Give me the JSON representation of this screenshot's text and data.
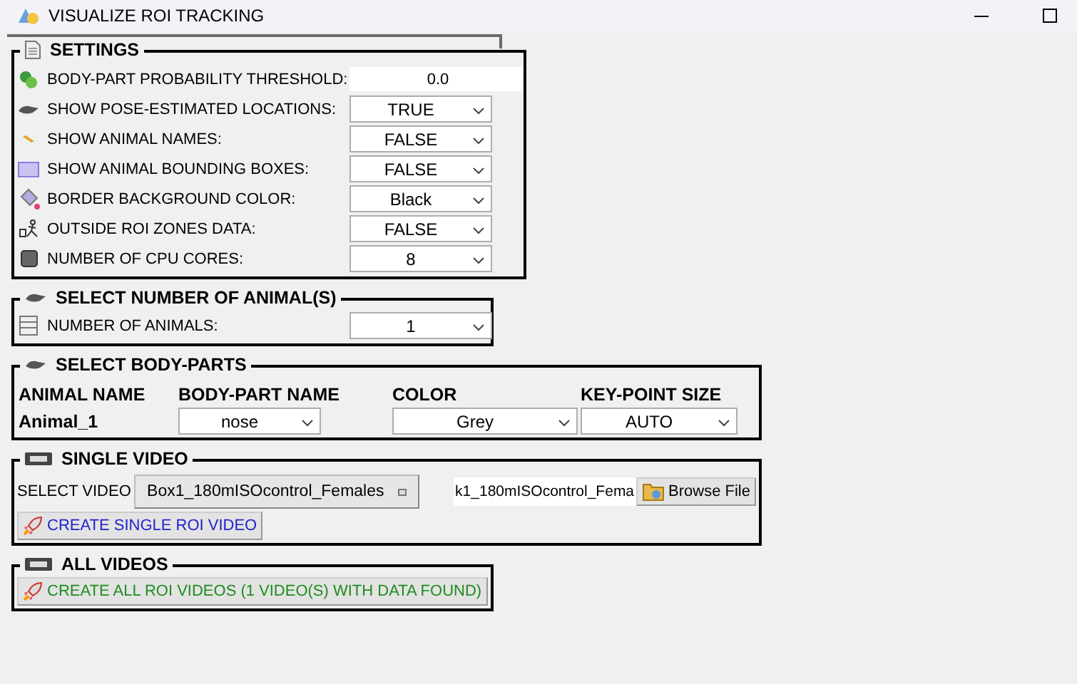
{
  "window": {
    "title": "VISUALIZE ROI TRACKING"
  },
  "settings": {
    "title": "SETTINGS",
    "rows": [
      {
        "kind": "entry",
        "label": "BODY-PART PROBABILITY THRESHOLD:",
        "value": "0.0"
      },
      {
        "kind": "dropdown",
        "label": "SHOW POSE-ESTIMATED LOCATIONS:",
        "value": "TRUE"
      },
      {
        "kind": "dropdown",
        "label": "SHOW ANIMAL NAMES:",
        "value": "FALSE"
      },
      {
        "kind": "dropdown",
        "label": "SHOW ANIMAL BOUNDING BOXES:",
        "value": "FALSE"
      },
      {
        "kind": "dropdown",
        "label": "BORDER BACKGROUND COLOR:",
        "value": "Black"
      },
      {
        "kind": "dropdown",
        "label": "OUTSIDE ROI ZONES DATA:",
        "value": "FALSE"
      },
      {
        "kind": "dropdown",
        "label": "NUMBER OF CPU CORES:",
        "value": "8"
      }
    ]
  },
  "animals": {
    "title": "SELECT NUMBER OF ANIMAL(S)",
    "label": "NUMBER OF ANIMALS:",
    "value": "1"
  },
  "body_parts": {
    "title": "SELECT BODY-PARTS",
    "columns": [
      "ANIMAL NAME",
      "BODY-PART NAME",
      "COLOR",
      "KEY-POINT SIZE"
    ],
    "rows": [
      {
        "animal": "Animal_1",
        "body_part": "nose",
        "color_choice": "Grey",
        "size": "AUTO"
      }
    ]
  },
  "single_video": {
    "title": "SINGLE VIDEO",
    "label": "SELECT VIDEO",
    "video": "Box1_180mISOcontrol_Females",
    "file": "k1_180mISOcontrol_Fema",
    "browse": "Browse File",
    "button": "CREATE SINGLE ROI VIDEO"
  },
  "all_videos": {
    "title": "ALL VIDEOS",
    "button": "CREATE ALL ROI VIDEOS (1 VIDEO(S) WITH DATA FOUND)"
  }
}
